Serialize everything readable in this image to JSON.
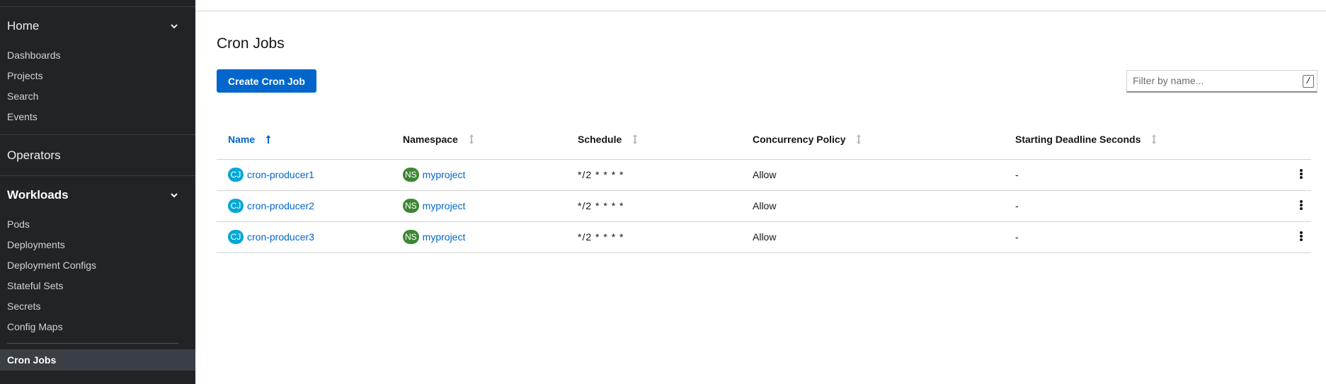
{
  "sidebar": {
    "home": {
      "label": "Home",
      "items": [
        {
          "label": "Dashboards"
        },
        {
          "label": "Projects"
        },
        {
          "label": "Search"
        },
        {
          "label": "Events"
        }
      ]
    },
    "operators": {
      "label": "Operators"
    },
    "workloads": {
      "label": "Workloads",
      "items": [
        {
          "label": "Pods"
        },
        {
          "label": "Deployments"
        },
        {
          "label": "Deployment Configs"
        },
        {
          "label": "Stateful Sets"
        },
        {
          "label": "Secrets"
        },
        {
          "label": "Config Maps"
        }
      ],
      "active_item": "Cron Jobs"
    }
  },
  "page": {
    "title": "Cron Jobs",
    "create_button": "Create Cron Job",
    "filter": {
      "placeholder": "Filter by name...",
      "shortcut": "/"
    }
  },
  "table": {
    "columns": [
      {
        "label": "Name",
        "sorted": "ascending"
      },
      {
        "label": "Namespace"
      },
      {
        "label": "Schedule"
      },
      {
        "label": "Concurrency Policy"
      },
      {
        "label": "Starting Deadline Seconds"
      }
    ],
    "rows": [
      {
        "kind_badge": "CJ",
        "name": "cron-producer1",
        "ns_badge": "NS",
        "namespace": "myproject",
        "schedule": "*/2 * * * *",
        "concurrency": "Allow",
        "deadline": "-"
      },
      {
        "kind_badge": "CJ",
        "name": "cron-producer2",
        "ns_badge": "NS",
        "namespace": "myproject",
        "schedule": "*/2 * * * *",
        "concurrency": "Allow",
        "deadline": "-"
      },
      {
        "kind_badge": "CJ",
        "name": "cron-producer3",
        "ns_badge": "NS",
        "namespace": "myproject",
        "schedule": "*/2 * * * *",
        "concurrency": "Allow",
        "deadline": "-"
      }
    ]
  },
  "colors": {
    "sidebar_bg": "#212427",
    "primary": "#0066cc",
    "cj_badge": "#00a8d5",
    "ns_badge": "#3e8635"
  },
  "icons": {
    "chevron": "chevron-down-icon",
    "sort_asc": "sort-ascending-icon",
    "sort": "sort-icon",
    "kebab": "kebab-menu-icon"
  }
}
